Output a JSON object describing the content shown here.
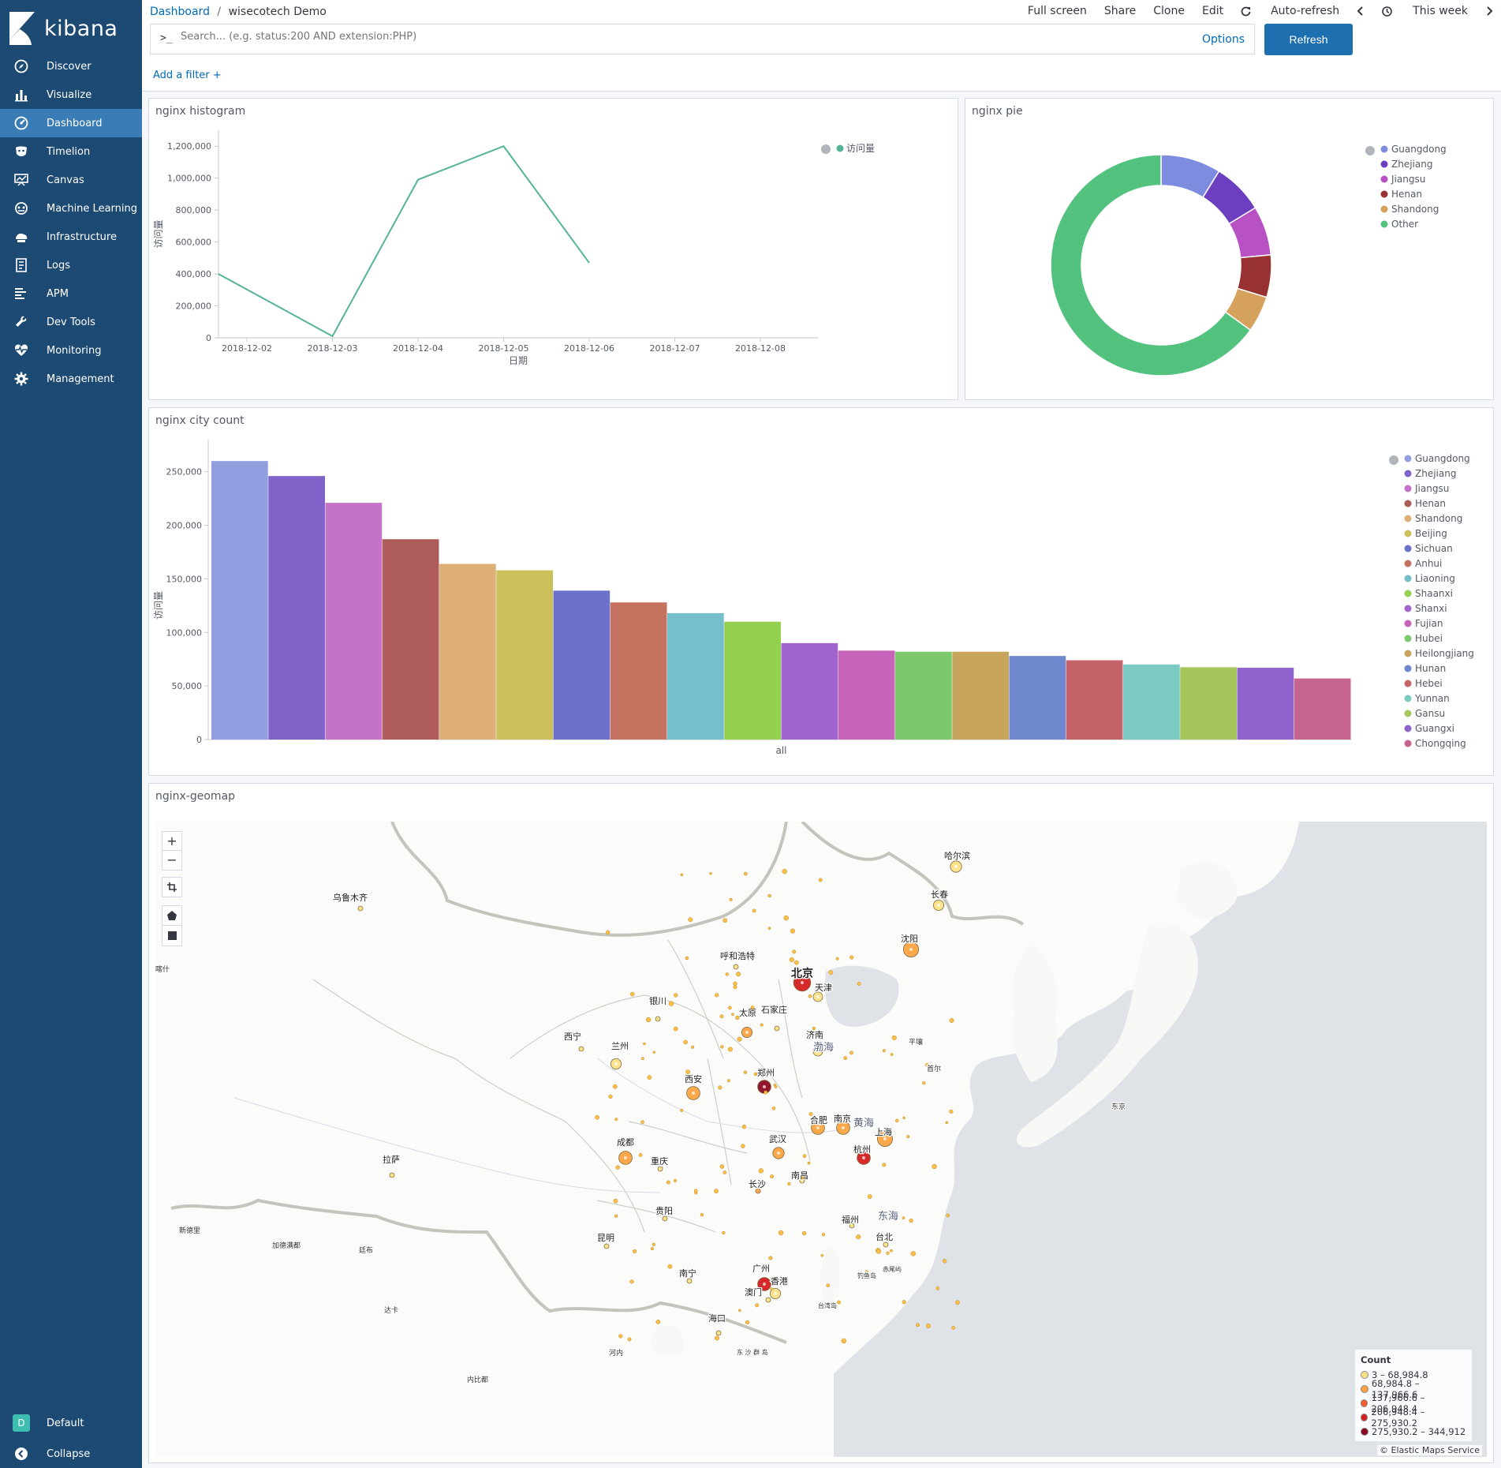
{
  "app": {
    "name": "kibana"
  },
  "nav": {
    "items": [
      {
        "label": "Discover",
        "icon": "compass-icon"
      },
      {
        "label": "Visualize",
        "icon": "bar-chart-icon"
      },
      {
        "label": "Dashboard",
        "icon": "dashboard-icon"
      },
      {
        "label": "Timelion",
        "icon": "timelion-icon"
      },
      {
        "label": "Canvas",
        "icon": "canvas-icon"
      },
      {
        "label": "Machine Learning",
        "icon": "ml-icon"
      },
      {
        "label": "Infrastructure",
        "icon": "infrastructure-icon"
      },
      {
        "label": "Logs",
        "icon": "logs-icon"
      },
      {
        "label": "APM",
        "icon": "apm-icon"
      },
      {
        "label": "Dev Tools",
        "icon": "wrench-icon"
      },
      {
        "label": "Monitoring",
        "icon": "heartbeat-icon"
      },
      {
        "label": "Management",
        "icon": "gear-icon"
      }
    ],
    "active": "Dashboard",
    "space_badge": "D",
    "space_label": "Default",
    "collapse_label": "Collapse"
  },
  "breadcrumb": {
    "root": "Dashboard",
    "separator": "/",
    "current": "wisecotech Demo"
  },
  "top_menu": {
    "full_screen": "Full screen",
    "share": "Share",
    "clone": "Clone",
    "edit": "Edit",
    "auto_refresh": "Auto-refresh",
    "time_range": "This week"
  },
  "search": {
    "prompt": ">_",
    "placeholder": "Search... (e.g. status:200 AND extension:PHP)",
    "options_label": "Options",
    "refresh_label": "Refresh"
  },
  "filter": {
    "add_label": "Add a filter +"
  },
  "panels": {
    "histogram": {
      "title": "nginx histogram"
    },
    "pie": {
      "title": "nginx pie"
    },
    "city": {
      "title": "nginx city count"
    },
    "geomap": {
      "title": "nginx-geomap"
    }
  },
  "chart_data": [
    {
      "type": "line",
      "x": [
        "2018-12-02",
        "2018-12-03",
        "2018-12-04",
        "2018-12-05",
        "2018-12-06",
        "2018-12-07",
        "2018-12-08"
      ],
      "series": [
        {
          "name": "访问量",
          "values": [
            400000,
            10000,
            990000,
            1200000,
            470000,
            null,
            null
          ],
          "color": "#54b399"
        }
      ],
      "xlabel": "日期",
      "ylabel": "访问量",
      "ylim": [
        0,
        1300000
      ],
      "yticks": [
        0,
        200000,
        400000,
        600000,
        800000,
        1000000,
        1200000
      ],
      "ytick_labels": [
        "0",
        "200,000",
        "400,000",
        "600,000",
        "800,000",
        "1,000,000",
        "1,200,000"
      ],
      "legend": "top-right"
    },
    {
      "type": "pie",
      "donut": true,
      "labels": [
        "Guangdong",
        "Zhejiang",
        "Jiangsu",
        "Henan",
        "Shandong",
        "Other"
      ],
      "values": [
        8.8,
        7.5,
        7.2,
        6.2,
        5.3,
        65.0
      ],
      "colors": [
        "#7e8ce0",
        "#6c3fc1",
        "#b751c4",
        "#983131",
        "#d6a15d",
        "#54c27f"
      ],
      "legend": "top-right"
    },
    {
      "type": "bar",
      "categories": [
        "Guangdong",
        "Zhejiang",
        "Jiangsu",
        "Henan",
        "Shandong",
        "Beijing",
        "Sichuan",
        "Anhui",
        "Liaoning",
        "Shaanxi",
        "Shanxi",
        "Fujian",
        "Hubei",
        "Heilongjiang",
        "Hunan",
        "Hebei",
        "Yunnan",
        "Gansu",
        "Guangxi",
        "Chongqing"
      ],
      "values": [
        260000,
        246000,
        221000,
        187000,
        164000,
        158000,
        139000,
        128000,
        118000,
        110000,
        90000,
        83000,
        82000,
        82000,
        78000,
        74000,
        70000,
        67500,
        67000,
        57000
      ],
      "colors": [
        "#919fe0",
        "#8063c8",
        "#c473c8",
        "#ad5c5a",
        "#deb077",
        "#cbc05c",
        "#6c72cc",
        "#c57260",
        "#74bfca",
        "#93d050",
        "#a065cc",
        "#c763b9",
        "#7cc96c",
        "#c7a55d",
        "#6f87cc",
        "#c56468",
        "#7ccbc2",
        "#a5c65a",
        "#9062cc",
        "#c4648f"
      ],
      "xlabel": "all",
      "ylabel": "访问量",
      "ylim": [
        0,
        280000
      ],
      "yticks": [
        0,
        50000,
        100000,
        150000,
        200000,
        250000
      ],
      "ytick_labels": [
        "0",
        "50,000",
        "100,000",
        "150,000",
        "200,000",
        "250,000"
      ],
      "legend": "right"
    }
  ],
  "geomap": {
    "controls": [
      "+",
      "−"
    ],
    "zoom_in_label": "+",
    "zoom_out_label": "−",
    "legend_title": "Count",
    "legend": [
      {
        "label": "3 – 68,984.8",
        "color": "#fee187"
      },
      {
        "label": "68,984.8 – 137,966.6",
        "color": "#fda441"
      },
      {
        "label": "137,966.6 – 206,948.4",
        "color": "#f45a2a"
      },
      {
        "label": "206,948.4 – 275,930.2",
        "color": "#d61e1f"
      },
      {
        "label": "275,930.2 – 344,912",
        "color": "#8d0923"
      }
    ],
    "attribution": "© Elastic Maps Service",
    "place_labels": {
      "wulumuqi": "乌鲁木齐",
      "haerbin": "哈尔滨",
      "changchun": "长春",
      "shenyang": "沈阳",
      "huhehaote": "呼和浩特",
      "beijing": "北京",
      "tianjin": "天津",
      "yinchuan": "银川",
      "taiyuan": "太原",
      "shijiazhuang": "石家庄",
      "jinan": "济南",
      "xining": "西宁",
      "lanzhou": "兰州",
      "zhengzhou": "郑州",
      "xian": "西安",
      "hefei": "合肥",
      "nanjing": "南京",
      "shanghai": "上海",
      "hangzhou": "杭州",
      "wuhan": "武汉",
      "chengdu": "成都",
      "chongqing": "重庆",
      "lasa": "拉萨",
      "nanchang": "南昌",
      "changsha": "长沙",
      "guiyang": "贵阳",
      "fuzhou": "福州",
      "kunming": "昆明",
      "taibei": "台北",
      "nanning": "南宁",
      "guangzhou": "广州",
      "xianggang": "香港",
      "aomen": "澳门",
      "haikou": "海口",
      "pingrang": "平壤",
      "shouer": "首尔",
      "dongjing": "东京",
      "bohai": "渤海",
      "huanghai": "黄海",
      "donghai": "东海",
      "xindeli": "新德里",
      "jiademan": "加德满都",
      "tingbu": "廷布",
      "dacca": "达卡",
      "hanoi": "河内",
      "neibidu": "内比都",
      "diaoyu": "钓鱼岛",
      "chiwei": "赤尾屿",
      "dongsha": "东 沙 群 岛",
      "taiwan": "台湾岛",
      "kashi": "喀什"
    }
  }
}
